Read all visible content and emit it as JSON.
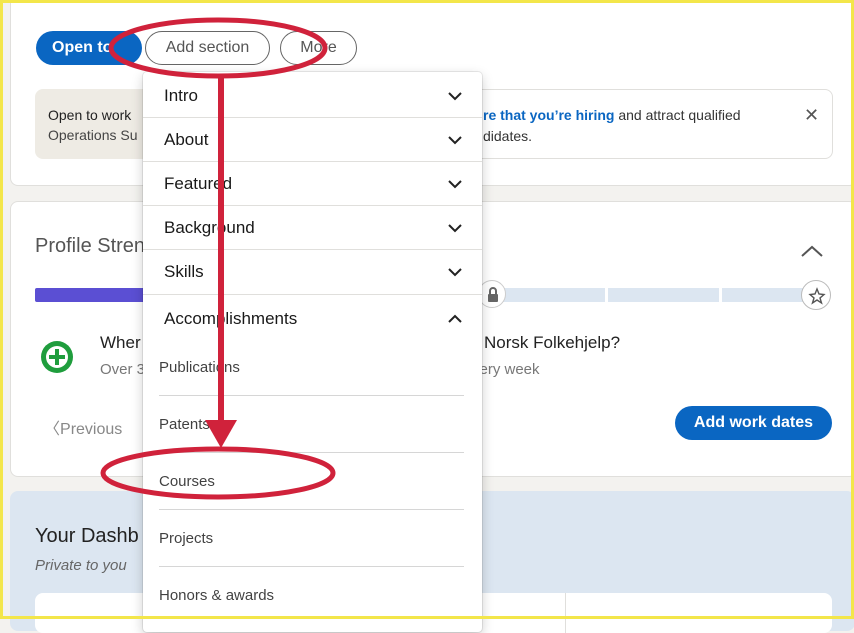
{
  "top_actions": {
    "open_to": "Open to",
    "add_section": "Add section",
    "more": "More"
  },
  "open_to_work_card": {
    "title": "Open to work",
    "subtitle": "Operations Su"
  },
  "hiring_card": {
    "link": "re that you’re hiring",
    "text": " and attract qualified",
    "text2": "didates.",
    "close": "✕"
  },
  "profile_strength": {
    "title": "Profile Stren",
    "progress_fraction": 0.22
  },
  "suggestion": {
    "title": "Wher",
    "title_right": "Norsk Folkehjelp?",
    "sub": "Over 3",
    "sub_right": "very week",
    "previous": "Previous",
    "add_work_dates": "Add work dates"
  },
  "dashboard": {
    "title": "Your Dashb",
    "private": "Private to you"
  },
  "dropdown": {
    "sections": [
      {
        "label": "Intro",
        "expanded": false
      },
      {
        "label": "About",
        "expanded": false
      },
      {
        "label": "Featured",
        "expanded": false
      },
      {
        "label": "Background",
        "expanded": false
      },
      {
        "label": "Skills",
        "expanded": false
      },
      {
        "label": "Accomplishments",
        "expanded": true
      }
    ],
    "accomplishments": [
      "Publications",
      "Patents",
      "Courses",
      "Projects",
      "Honors & awards"
    ]
  },
  "annotation_color": "#d0223b"
}
